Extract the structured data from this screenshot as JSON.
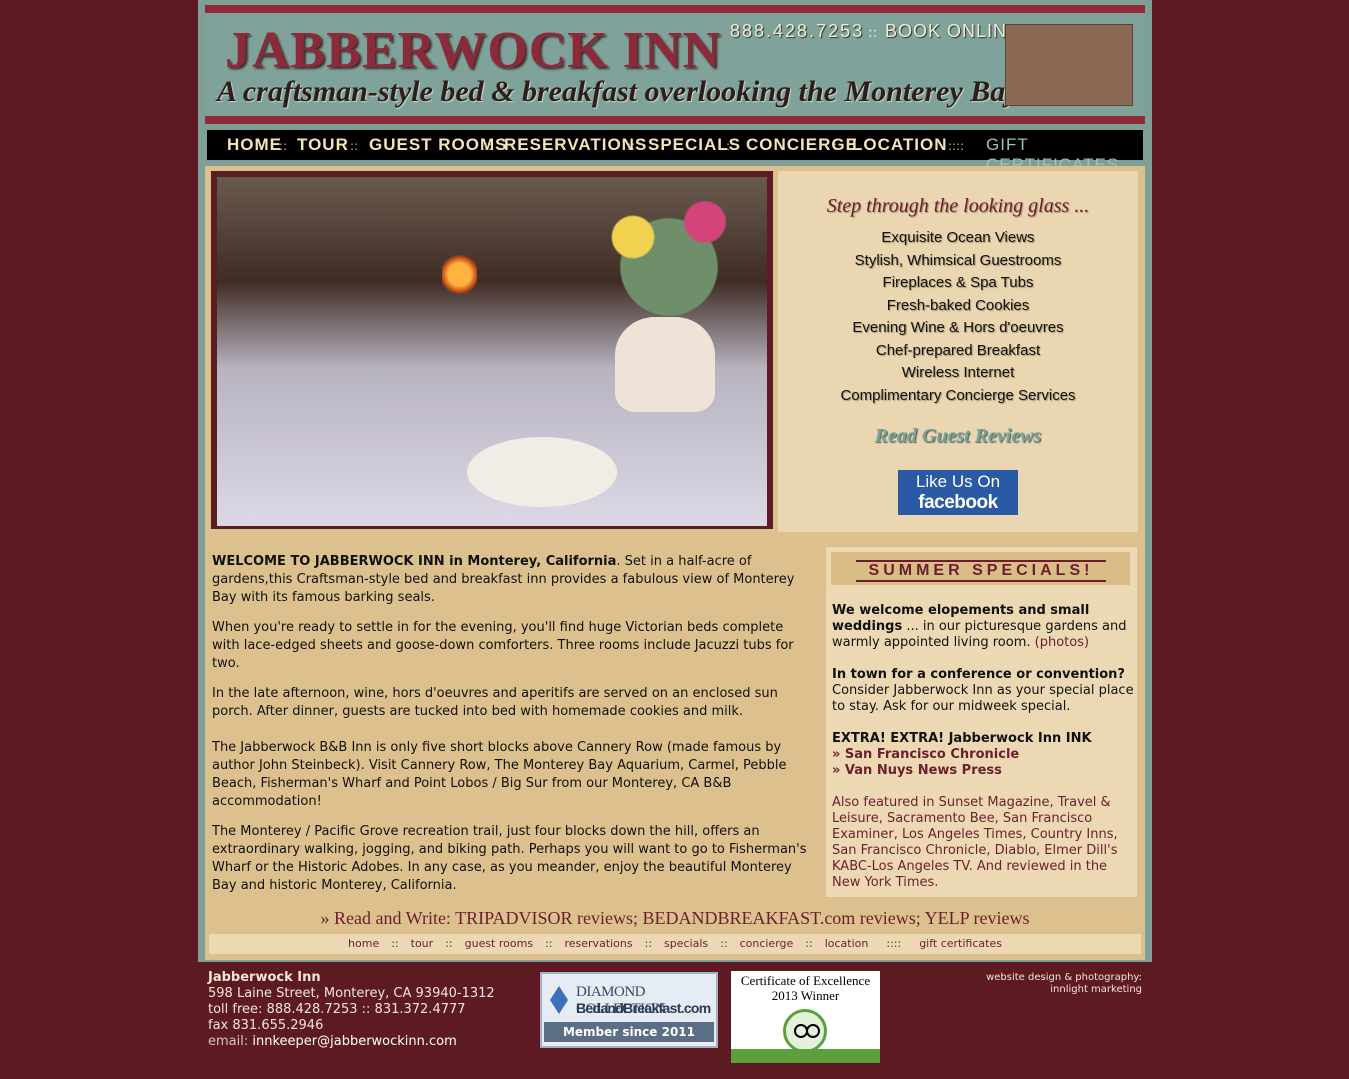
{
  "header": {
    "title": "JABBERWOCK INN",
    "tagline": "A craftsman-style bed & breakfast overlooking the Monterey Bay",
    "phone": "888.428.7253",
    "separator": "::",
    "book": "BOOK ONLINE"
  },
  "nav": {
    "items": [
      "HOME",
      "TOUR",
      "GUEST ROOMS",
      "RESERVATIONS",
      "SPECIALS",
      "CONCIERGE",
      "LOCATION"
    ],
    "sep": "::",
    "gift_sep": "::::",
    "gift": "GIFT CERTIFICATES"
  },
  "side": {
    "step": "Step through the looking glass ...",
    "features": [
      "Exquisite Ocean Views",
      "Stylish, Whimsical Guestrooms",
      "Fireplaces & Spa Tubs",
      "Fresh-baked Cookies",
      "Evening Wine  & Hors d'oeuvres",
      "Chef-prepared Breakfast",
      "Wireless Internet",
      "Complimentary Concierge Services"
    ],
    "reviews": "Read Guest Reviews",
    "fb_line1": "Like Us On",
    "fb_line2": "facebook"
  },
  "main": {
    "p1_bold": "WELCOME TO JABBERWOCK INN in Monterey, California",
    "p1_rest": ". Set in a half-acre of gardens,this Craftsman-style bed and breakfast inn provides a fabulous view of Monterey Bay with its famous barking seals.",
    "p2": "When you're ready to settle in for the evening, you'll find huge Victorian beds complete with lace-edged sheets and goose-down comforters. Three rooms include Jacuzzi tubs for two.",
    "p3": "In the late afternoon, wine, hors d'oeuvres and aperitifs are served on an enclosed sun porch. After dinner, guests are tucked into bed with homemade cookies and milk.",
    "p4": "The Jabberwock B&B Inn is only five short blocks above Cannery Row (made famous by author John Steinbeck). Visit Cannery Row, The Monterey Bay Aquarium, Carmel, Pebble Beach, Fisherman's Wharf and Point Lobos / Big Sur from our Monterey, CA B&B accommodation!",
    "p5": "The Monterey / Pacific Grove recreation trail, just four blocks down the hill, offers an extraordinary walking, jogging, and biking path. Perhaps you will want to go to Fisherman's Wharf or the Historic Adobes. In any case, as you meander, enjoy the beautiful Monterey Bay and historic Monterey, California."
  },
  "specials": {
    "title": "SUMMER SPECIALS!",
    "s1_bold": "We welcome elopements and small weddings",
    "s1_rest": " ... in our picturesque gardens and warmly appointed living room. ",
    "s1_link": "(photos)",
    "s2_bold": "In town for a conference or convention?",
    "s2_rest": "Consider Jabberwock Inn as your special place to stay. Ask for our midweek special.",
    "s3_bold": "EXTRA! EXTRA! Jabberwock Inn INK",
    "link1": "» San Francisco Chronicle",
    "link2": "» Van Nuys News Press",
    "featured": "Also featured in Sunset Magazine, Travel & Leisure, Sacramento Bee, San Francisco Examiner, Los Angeles Times, Country Inns, San Francisco Chronicle, Diablo, Elmer Dill's KABC-Los Angeles TV. And reviewed in the New York Times."
  },
  "readwrite": {
    "prefix": "» Read and Write: ",
    "trip": "TRIPADVISOR reviews",
    "semi1": "; ",
    "bnb": "BEDANDBREAKFAST.com reviews",
    "semi2": "; ",
    "yelp": "YELP reviews"
  },
  "footnav": {
    "items": [
      "home",
      "tour",
      "guest rooms",
      "reservations",
      "specials",
      "concierge",
      "location"
    ],
    "sep": "::",
    "gift_sep": "::::",
    "gift": "gift certificates"
  },
  "footer": {
    "name": "Jabberwock Inn",
    "street": "598 Laine Street, Monterey, CA 93940-1312",
    "tollfree": "toll free: 888.428.7253 :: 831.372.4777",
    "fax": "fax 831.655.2946",
    "email_label": "email: ",
    "email": "innkeeper@jabberwockinn.com",
    "credit1": "website design & photography:",
    "credit2": "innlight marketing"
  },
  "badges": {
    "diamond1": "DIAMOND COLLECTION",
    "diamond2": "BedandBreakfast.com",
    "diamond3": "Member since 2011",
    "ta1": "Certificate of Excellence",
    "ta2": "2013 Winner"
  },
  "colors": {
    "background": "#5e1a22",
    "accent": "#6b1f2e",
    "panel": "#dcc18e",
    "frame": "#7e9e96"
  }
}
